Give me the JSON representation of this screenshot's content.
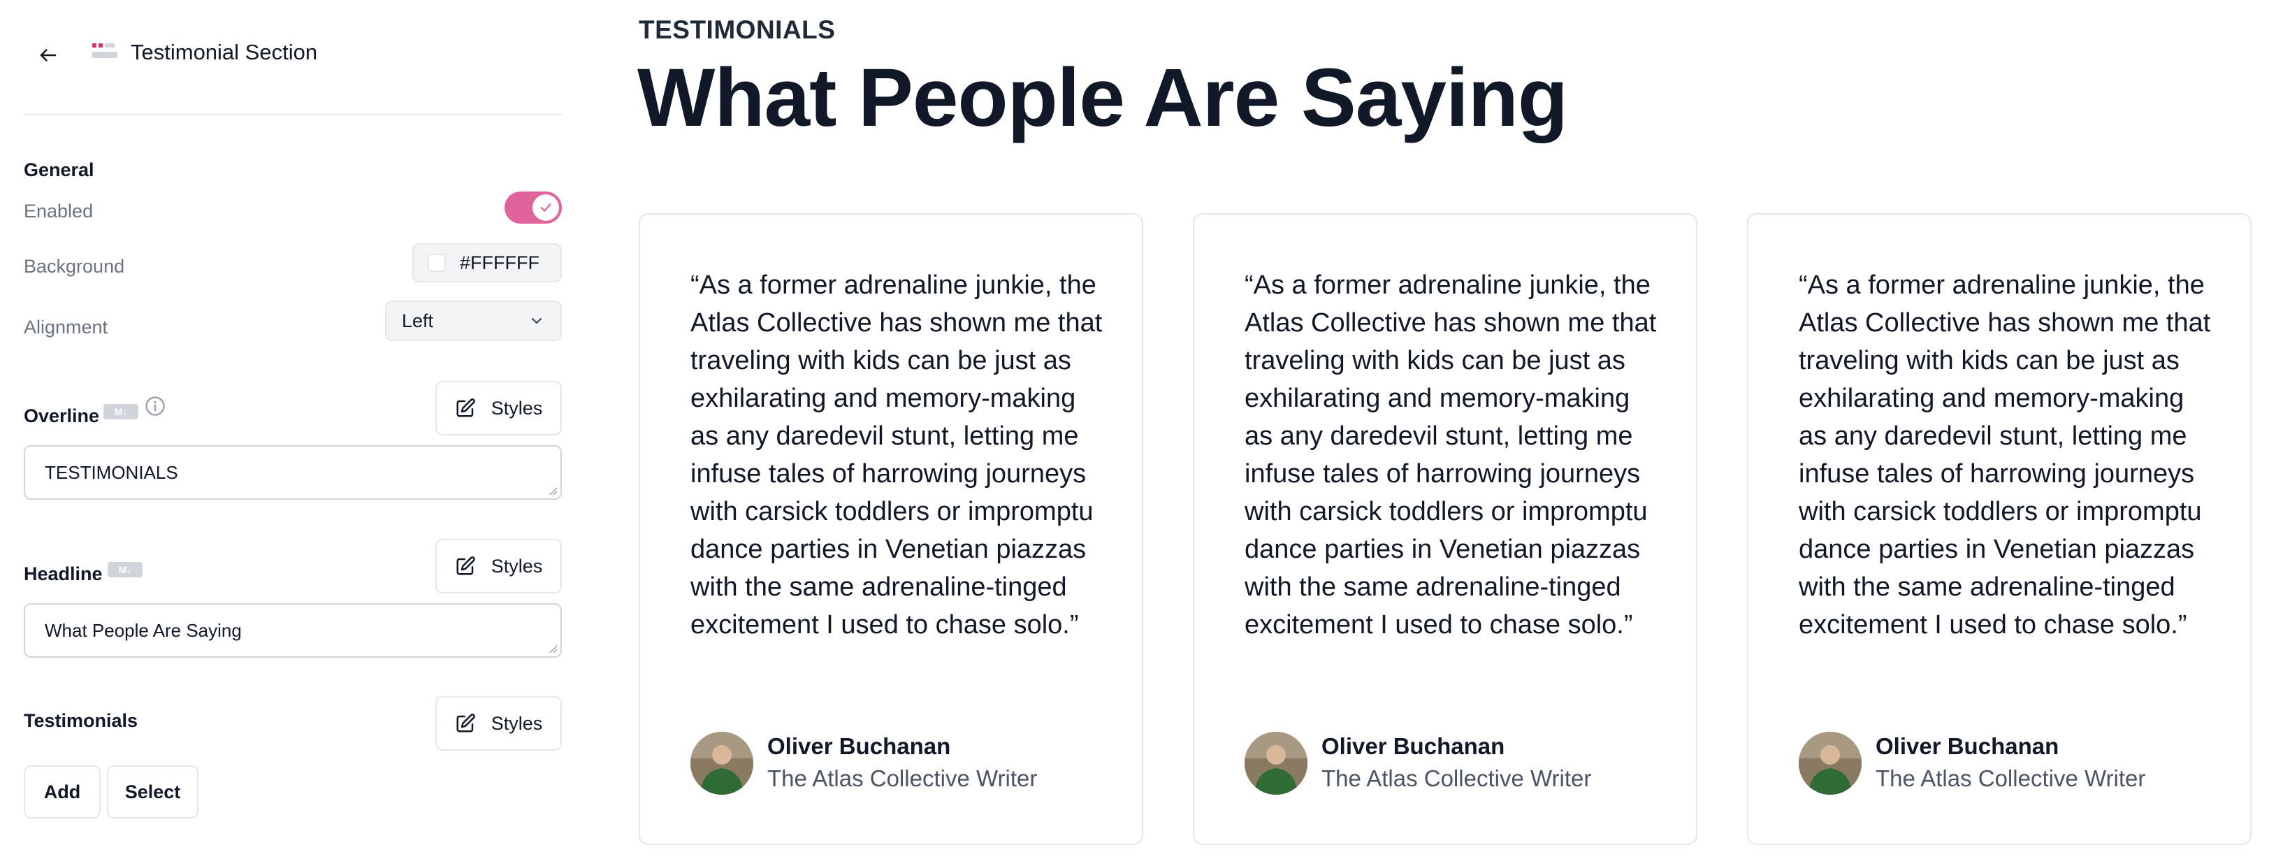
{
  "sidebar": {
    "title": "Testimonial Section",
    "icons": {
      "back": "arrow-left-icon",
      "section": "testimonial-section-icon"
    },
    "general": {
      "label": "General",
      "enabled_label": "Enabled",
      "enabled": true,
      "background_label": "Background",
      "background_value": "#FFFFFF",
      "alignment_label": "Alignment",
      "alignment_value": "Left"
    },
    "overline": {
      "label": "Overline",
      "markdown_badge": "M↓",
      "styles_label": "Styles",
      "value": "TESTIMONIALS"
    },
    "headline": {
      "label": "Headline",
      "markdown_badge": "M↓",
      "styles_label": "Styles",
      "value": "What People Are Saying"
    },
    "testimonials": {
      "label": "Testimonials",
      "styles_label": "Styles",
      "add_label": "Add",
      "select_label": "Select"
    },
    "colors": {
      "accent": "#E0649B",
      "border": "#E5E7EB",
      "muted_text": "#6B7280"
    }
  },
  "preview": {
    "overline": "TESTIMONIALS",
    "headline": "What People Are Saying",
    "cards": [
      {
        "quote": "“As a former adrenaline junkie, the Atlas Collective has shown me that traveling with kids can be just as exhilarating and memory-making as any daredevil stunt, letting me infuse tales of harrowing journeys with carsick toddlers or impromptu dance parties in Venetian piazzas with the same adrenaline-tinged excitement I used to chase solo.”",
        "author_name": "Oliver Buchanan",
        "author_role": "The Atlas Collective Writer"
      },
      {
        "quote": "“As a former adrenaline junkie, the Atlas Collective has shown me that traveling with kids can be just as exhilarating and memory-making as any daredevil stunt, letting me infuse tales of harrowing journeys with carsick toddlers or impromptu dance parties in Venetian piazzas with the same adrenaline-tinged excitement I used to chase solo.”",
        "author_name": "Oliver Buchanan",
        "author_role": "The Atlas Collective Writer"
      },
      {
        "quote": "“As a former adrenaline junkie, the Atlas Collective has shown me that traveling with kids can be just as exhilarating and memory-making as any daredevil stunt, letting me infuse tales of harrowing journeys with carsick toddlers or impromptu dance parties in Venetian piazzas with the same adrenaline-tinged excitement I used to chase solo.”",
        "author_name": "Oliver Buchanan",
        "author_role": "The Atlas Collective Writer"
      }
    ]
  }
}
